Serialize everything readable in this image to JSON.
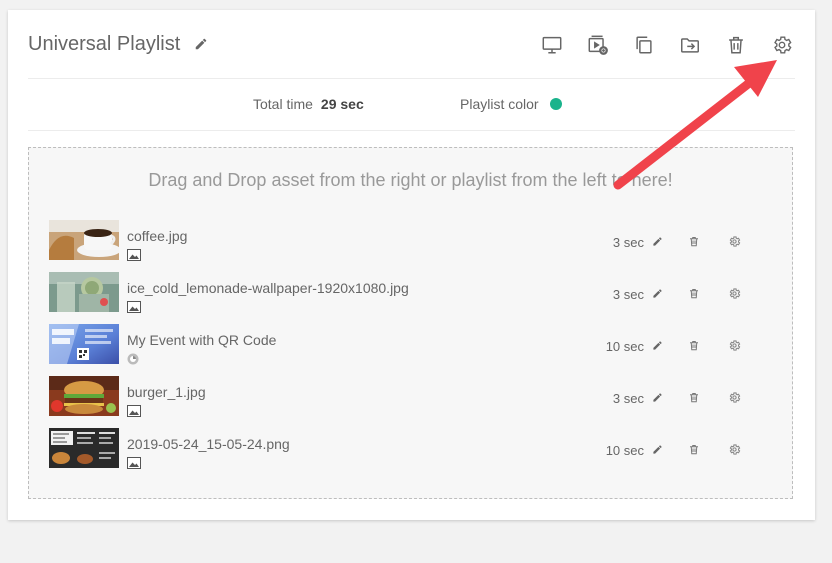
{
  "playlist": {
    "title": "Universal Playlist",
    "total_time_label": "Total time",
    "total_time_value": "29 sec",
    "color_label": "Playlist color",
    "color": "#1ab38c"
  },
  "toolbar": {
    "icons": [
      "monitor-icon",
      "preview-play-icon",
      "duplicate-icon",
      "move-to-folder-icon",
      "trash-icon",
      "gear-icon"
    ]
  },
  "dropzone": {
    "hint": "Drag and Drop asset from the right or playlist from the left to here!"
  },
  "assets": [
    {
      "name": "coffee.jpg",
      "type": "image",
      "duration": "3 sec"
    },
    {
      "name": "ice_cold_lemonade-wallpaper-1920x1080.jpg",
      "type": "image",
      "duration": "3 sec"
    },
    {
      "name": "My Event with QR Code",
      "type": "template",
      "duration": "10 sec"
    },
    {
      "name": "burger_1.jpg",
      "type": "image",
      "duration": "3 sec"
    },
    {
      "name": "2019-05-24_15-05-24.png",
      "type": "image",
      "duration": "10 sec"
    }
  ],
  "annotation": {
    "arrow_color": "#f0434b"
  }
}
